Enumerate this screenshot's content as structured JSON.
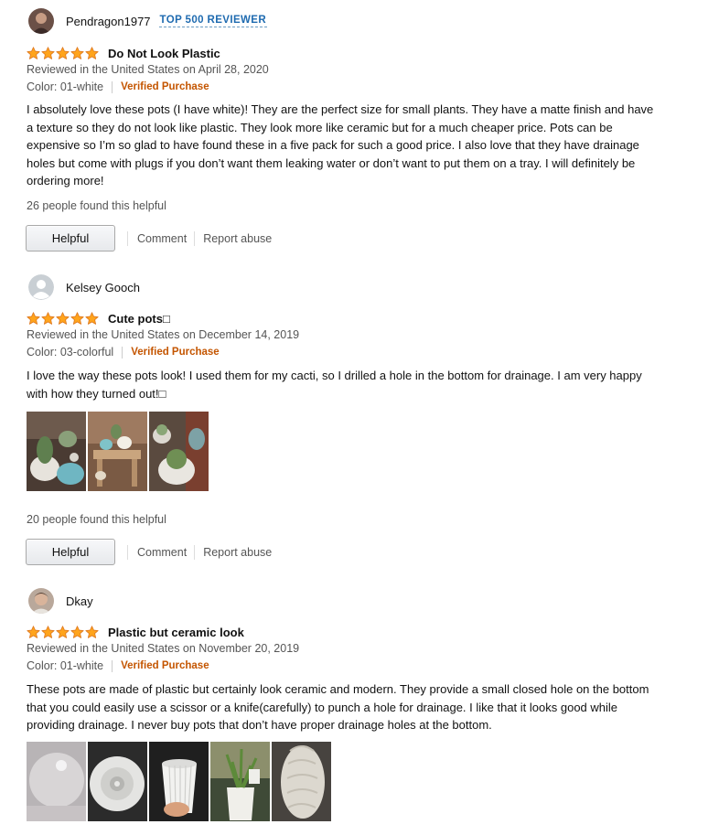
{
  "reviews": [
    {
      "name": "Pendragon1977",
      "badge": "TOP 500 REVIEWER",
      "rating": 5,
      "title": "Do Not Look Plastic",
      "date": "Reviewed in the United States on April 28, 2020",
      "variant": "Color: 01-white",
      "verified": "Verified Purchase",
      "body": "I absolutely love these pots (I have white)! They are the perfect size for small plants. They have a matte finish and have a texture so they do not look like plastic. They look more like ceramic but for a much cheaper price. Pots can be expensive so I’m so glad to have found these in a five pack for such a good price. I also love that they have drainage holes but come with plugs if you don’t want them leaking water or don’t want to put them on a tray. I will definitely be ordering more!",
      "helpful_count": "26 people found this helpful",
      "helpful_label": "Helpful",
      "comment_label": "Comment",
      "report_label": "Report abuse"
    },
    {
      "name": "Kelsey Gooch",
      "rating": 5,
      "title": "Cute pots□",
      "date": "Reviewed in the United States on December 14, 2019",
      "variant": "Color: 03-colorful",
      "verified": "Verified Purchase",
      "body": "I love the way these pots look! I used them for my cacti, so I drilled a hole in the bottom for drainage. I am very happy with how they turned out!□",
      "helpful_count": "20 people found this helpful",
      "helpful_label": "Helpful",
      "comment_label": "Comment",
      "report_label": "Report abuse"
    },
    {
      "name": "Dkay",
      "rating": 5,
      "title": "Plastic but ceramic look",
      "date": "Reviewed in the United States on November 20, 2019",
      "variant": "Color: 01-white",
      "verified": "Verified Purchase",
      "body": "These pots are made of plastic but certainly look ceramic and modern. They provide a small closed hole on the bottom that you could easily use a scissor or a knife(carefully) to punch a hole for drainage. I like that it looks good while providing drainage. I never buy pots that don’t have proper drainage holes at the bottom."
    }
  ],
  "colors": {
    "star": "#ffa41c",
    "verified": "#c45500",
    "badge": "#1f6bb0",
    "meta_text": "#555555"
  },
  "icons": [
    "star-icon",
    "default-avatar-icon"
  ]
}
